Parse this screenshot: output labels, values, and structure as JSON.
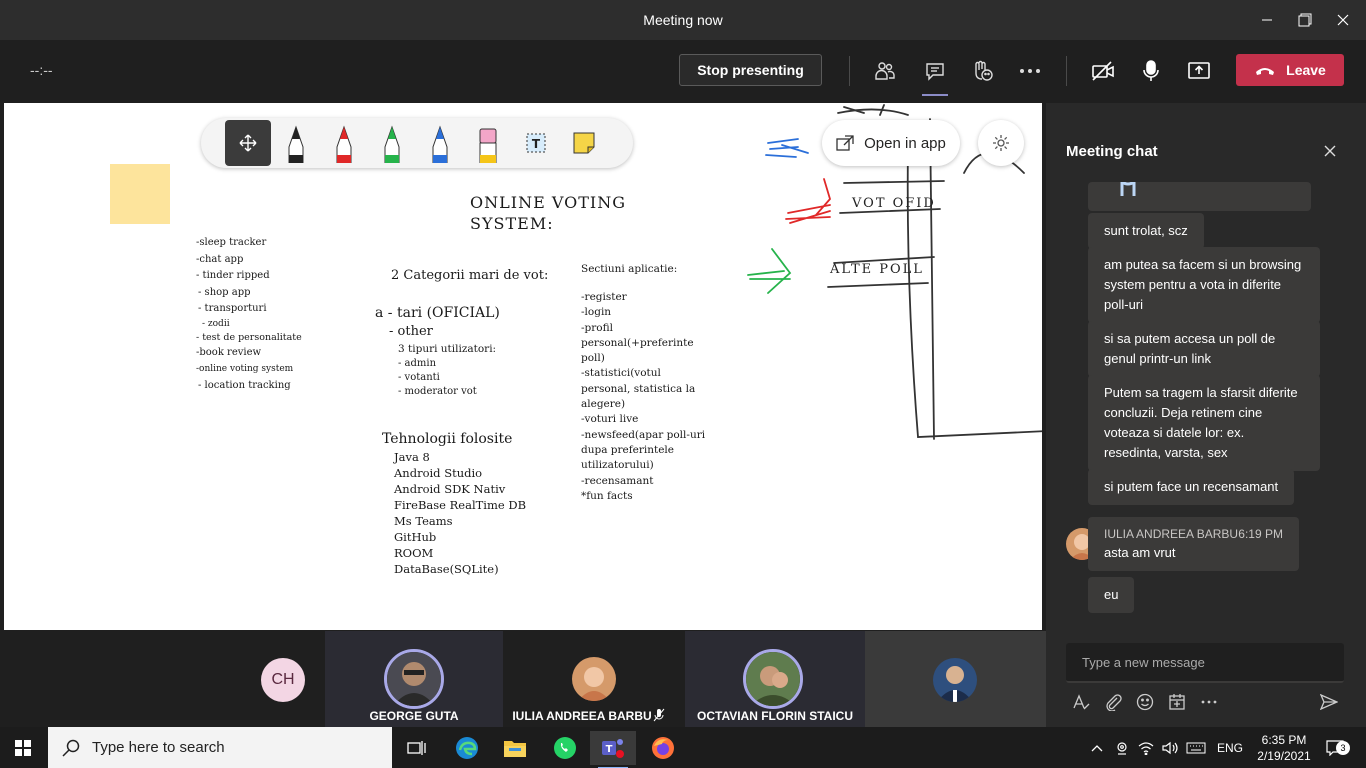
{
  "window": {
    "title": "Meeting now"
  },
  "toolbar": {
    "timer": "--:--",
    "stop_presenting": "Stop presenting",
    "leave": "Leave"
  },
  "whiteboard": {
    "open_in_app": "Open in app",
    "title_line1": "ONLINE VOTING",
    "title_line2": "SYSTEM:",
    "ideas": [
      "-sleep tracker",
      "-chat app",
      "- tinder ripped",
      "- shop app",
      "- transporturi",
      "- zodii",
      "- test de personalitate",
      "-book review",
      "-online voting system",
      "- location tracking"
    ],
    "categories_title": "2 Categorii mari de vot:",
    "cat_a": "a - tari (OFICIAL)",
    "cat_other": "- other",
    "users_title": "3 tipuri utilizatori:",
    "users": [
      "- admin",
      "- votanti",
      "- moderator vot"
    ],
    "tech_title": "Tehnologii folosite",
    "tech": [
      "Java 8",
      "Android Studio",
      "Android SDK Nativ",
      "FireBase RealTime DB",
      "Ms Teams",
      "GitHub",
      "ROOM",
      "DataBase(SQLite)"
    ],
    "sections_title": "Sectiuni aplicatie:",
    "sections": [
      "-register",
      "-login",
      "-profil",
      "personal(+preferinte",
      "poll)",
      "-statistici(votul",
      "personal, statistica la",
      "alegere)",
      "-voturi live",
      "-newsfeed(apar poll-uri",
      "dupa preferintele",
      "utilizatorului)",
      "-recensamant",
      "*fun facts"
    ],
    "sketch_text1": "VOT OFID",
    "sketch_text2": "ALTE POLL"
  },
  "participants": [
    {
      "initials": "CH"
    },
    {
      "name": "GEORGE GUTA"
    },
    {
      "name": "IULIA ANDREEA BARBU"
    },
    {
      "name": "OCTAVIAN FLORIN STAICU"
    },
    {
      "name": ""
    }
  ],
  "chat": {
    "title": "Meeting chat",
    "messages": [
      "sunt trolat, scz",
      "am putea sa facem si un browsing system pentru a vota in diferite poll-uri",
      "si sa putem accesa un poll de genul printr-un link",
      "Putem sa tragem la sfarsit diferite concluzii. Deja retinem cine voteaza si datele lor: ex. resedinta, varsta, sex",
      "si putem face un recensamant"
    ],
    "sender": "IULIA ANDREEA BARBU",
    "sender_time": "6:19 PM",
    "sender_msg": "asta am vrut",
    "followup": "eu",
    "placeholder": "Type a new message"
  },
  "taskbar": {
    "search_placeholder": "Type here to search",
    "lang": "ENG",
    "time": "6:35 PM",
    "date": "2/19/2021",
    "notif_count": "3"
  }
}
